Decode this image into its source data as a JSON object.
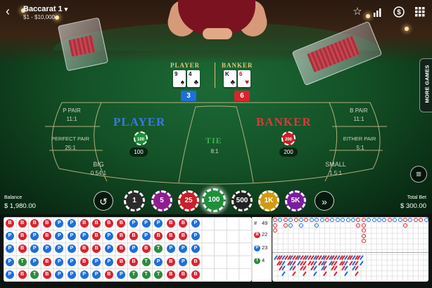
{
  "header": {
    "title": "Baccarat 1",
    "limits": "$1 - $10,000"
  },
  "more_games": "MORE GAMES",
  "hands": {
    "player_label": "PLAYER",
    "banker_label": "BANKER",
    "player_cards": [
      {
        "rank": "9",
        "suit": "♠",
        "color": "black"
      },
      {
        "rank": "4",
        "suit": "♣",
        "color": "black"
      }
    ],
    "banker_cards": [
      {
        "rank": "K",
        "suit": "♣",
        "color": "black"
      },
      {
        "rank": "6",
        "suit": "♥",
        "color": "red"
      }
    ],
    "player_score": "3",
    "banker_score": "6",
    "player_score_color": "#1e6fd9",
    "banker_score_color": "#d9242f"
  },
  "table": {
    "p_pair": "P PAIR",
    "p_pair_odds": "11:1",
    "perfect_pair": "PERFECT PAIR",
    "perfect_pair_odds": "25:1",
    "big": "BIG",
    "big_odds": "0.54:1",
    "player": "PLAYER",
    "tie": "TIE",
    "tie_odds": "8:1",
    "banker": "BANKER",
    "b_pair": "B PAIR",
    "b_pair_odds": "11:1",
    "either_pair": "EITHER PAIR",
    "either_pair_odds": "5:1",
    "small": "SMALL",
    "small_odds": "1.5:1",
    "player_bet_chip": "100",
    "player_bet_amount": "100",
    "banker_bet_chip": "200",
    "banker_bet_amount": "200"
  },
  "balance": {
    "label": "Balance",
    "value": "$ 1,980.00"
  },
  "total_bet": {
    "label": "Total Bet",
    "value": "$ 300.00"
  },
  "chips": [
    {
      "value": "1",
      "color": "#2b2b2b"
    },
    {
      "value": "5",
      "color": "#8d1f8f"
    },
    {
      "value": "25",
      "color": "#c8202a"
    },
    {
      "value": "100",
      "color": "#1f8f3a",
      "selected": true
    },
    {
      "value": "500",
      "color": "#222222"
    },
    {
      "value": "1K",
      "color": "#d19a12"
    },
    {
      "value": "5K",
      "color": "#7a1d9e"
    }
  ],
  "stats": {
    "total_label": "#",
    "total": "49",
    "banker_letter": "B",
    "banker": "22",
    "player_letter": "P",
    "player": "23",
    "tie_letter": "T",
    "tie": "4"
  },
  "colors": {
    "banker": "#d9242f",
    "player": "#1e6fd9",
    "tie": "#2e8b3e",
    "banker_special": "#8b5a2b"
  },
  "bead_road": [
    [
      "B",
      "P",
      "P",
      "P",
      "P"
    ],
    [
      "B",
      "B",
      "B",
      "T",
      "B"
    ],
    [
      "B",
      "P",
      "P",
      "P",
      "T"
    ],
    [
      "B",
      "B",
      "P",
      "B",
      "B"
    ],
    [
      "P",
      "P",
      "P",
      "P",
      "P"
    ],
    [
      "P",
      "P",
      "P",
      "P",
      "P"
    ],
    [
      "B",
      "P",
      "B",
      "B",
      "P"
    ],
    [
      "B",
      "B",
      "B",
      "P",
      "P"
    ],
    [
      "B",
      "P",
      "P",
      "P",
      "B"
    ],
    [
      "B",
      "B",
      "B",
      "B",
      "P"
    ],
    [
      "P",
      "B",
      "P",
      "B",
      "T"
    ],
    [
      "P",
      "P",
      "B",
      "T",
      "T"
    ],
    [
      "P",
      "B",
      "T",
      "P",
      "T"
    ],
    [
      "B",
      "B",
      "P",
      "B",
      "B"
    ],
    [
      "B",
      "B",
      "P",
      "P",
      "B"
    ],
    [
      "P",
      "P",
      "P",
      "B",
      "B"
    ]
  ],
  "icons": {
    "back": "chevron-left-icon",
    "favorite": "star-icon",
    "stats": "bar-chart-icon",
    "cashier": "dollar-icon",
    "lobby": "grid-icon",
    "undo": "undo-icon",
    "repeat": "double-arrow-icon",
    "menu": "menu-icon"
  }
}
